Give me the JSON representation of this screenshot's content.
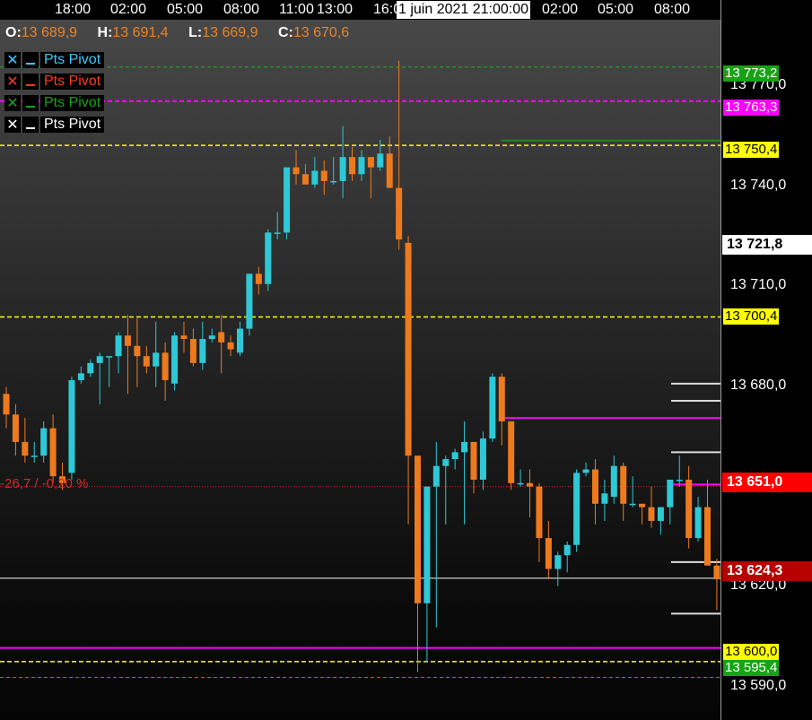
{
  "time_axis": {
    "labels": [
      "18:00",
      "02:00",
      "05:00",
      "08:00",
      "11:00",
      "13:00",
      "16:0",
      "02:00",
      "05:00",
      "08:00"
    ],
    "crosshair_time": "1 juin 2021 21:00:00"
  },
  "ohlc": {
    "open_label": "O:",
    "open": "13 689,9",
    "high_label": "H:",
    "high": "13 691,4",
    "low_label": "L:",
    "low": "13 669,9",
    "close_label": "C:",
    "close": "13 670,6"
  },
  "pivot_legends": [
    {
      "name": "Pts Pivot",
      "color": "#3fc8ff",
      "close_glyph": "✕"
    },
    {
      "name": "Pts Pivot",
      "color": "#ff3b1f",
      "close_glyph": "✕"
    },
    {
      "name": "Pts Pivot",
      "color": "#17a317",
      "close_glyph": "✕"
    },
    {
      "name": "Pts Pivot",
      "color": "#ffffff",
      "close_glyph": "✕"
    }
  ],
  "variation_label": "-26,7 / -0,20 %",
  "price_axis": {
    "ticks": [
      "13 770,0",
      "13 740,0",
      "13 710,0",
      "13 680,0",
      "13 620,0",
      "13 590,0"
    ],
    "badges": [
      {
        "label": "13 773,2",
        "bg": "#16a316",
        "fg": "#ffffff"
      },
      {
        "label": "13 763,3",
        "bg": "#ff00ff",
        "fg": "#ffffff"
      },
      {
        "label": "13 750,4",
        "bg": "#ffff00",
        "fg": "#000000"
      },
      {
        "label": "13 721,8",
        "bg": "#ffffff",
        "fg": "#000000",
        "big": true
      },
      {
        "label": "13 700,4",
        "bg": "#ffff00",
        "fg": "#000000"
      },
      {
        "label": "13 651,0",
        "bg": "#ff0000",
        "fg": "#ffffff",
        "big": true
      },
      {
        "label": "13 624,3",
        "bg": "#b80000",
        "fg": "#ffffff",
        "big": true
      },
      {
        "label": "13 600,0",
        "bg": "#ffff00",
        "fg": "#000000"
      },
      {
        "label": "13 595,4",
        "bg": "#16a316",
        "fg": "#ffffff"
      }
    ]
  },
  "colors": {
    "bull": "#2ec9d6",
    "bear": "#ee7a1e",
    "wick": "#d9d9d9",
    "pivot_green": "#1fb31f",
    "pivot_magenta": "#ff00ff",
    "pivot_yellow": "#ffff00",
    "current_price_line": "#ffffff",
    "reference_line": "#d21a1a"
  },
  "chart_data": {
    "type": "candlestick",
    "price_range": [
      13583,
      13787
    ],
    "pivot_levels": {
      "green": [
        13773.2,
        13595.4
      ],
      "magenta": [
        13763.3,
        13604.0
      ],
      "yellow": [
        13750.4,
        13700.4,
        13600.0
      ]
    },
    "current_price": 13624.3,
    "reference_price": 13651.0,
    "candles": [
      {
        "o": 13678,
        "h": 13680,
        "l": 13668,
        "c": 13672
      },
      {
        "o": 13672,
        "h": 13675,
        "l": 13660,
        "c": 13664
      },
      {
        "o": 13664,
        "h": 13671,
        "l": 13658,
        "c": 13660
      },
      {
        "o": 13660,
        "h": 13664,
        "l": 13658,
        "c": 13660
      },
      {
        "o": 13660,
        "h": 13670,
        "l": 13658,
        "c": 13668
      },
      {
        "o": 13668,
        "h": 13672,
        "l": 13652,
        "c": 13654
      },
      {
        "o": 13654,
        "h": 13658,
        "l": 13650,
        "c": 13652
      },
      {
        "o": 13655,
        "h": 13683,
        "l": 13653,
        "c": 13682
      },
      {
        "o": 13682,
        "h": 13686,
        "l": 13681,
        "c": 13684
      },
      {
        "o": 13684,
        "h": 13688,
        "l": 13683,
        "c": 13687
      },
      {
        "o": 13687,
        "h": 13690,
        "l": 13675,
        "c": 13689
      },
      {
        "o": 13689,
        "h": 13689,
        "l": 13680,
        "c": 13689
      },
      {
        "o": 13689,
        "h": 13696,
        "l": 13684,
        "c": 13695
      },
      {
        "o": 13695,
        "h": 13701,
        "l": 13678,
        "c": 13692
      },
      {
        "o": 13692,
        "h": 13700,
        "l": 13680,
        "c": 13689
      },
      {
        "o": 13689,
        "h": 13692,
        "l": 13684,
        "c": 13686
      },
      {
        "o": 13686,
        "h": 13699,
        "l": 13680,
        "c": 13690
      },
      {
        "o": 13690,
        "h": 13693,
        "l": 13676,
        "c": 13682
      },
      {
        "o": 13681,
        "h": 13696,
        "l": 13679,
        "c": 13695
      },
      {
        "o": 13695,
        "h": 13699,
        "l": 13690,
        "c": 13694
      },
      {
        "o": 13694,
        "h": 13697,
        "l": 13686,
        "c": 13687
      },
      {
        "o": 13687,
        "h": 13699,
        "l": 13685,
        "c": 13694
      },
      {
        "o": 13694,
        "h": 13697,
        "l": 13693,
        "c": 13695
      },
      {
        "o": 13696,
        "h": 13701,
        "l": 13684,
        "c": 13693
      },
      {
        "o": 13693,
        "h": 13695,
        "l": 13689,
        "c": 13691
      },
      {
        "o": 13690,
        "h": 13699,
        "l": 13689,
        "c": 13697
      },
      {
        "o": 13697,
        "h": 13710,
        "l": 13695,
        "c": 13713
      },
      {
        "o": 13713,
        "h": 13715,
        "l": 13707,
        "c": 13710
      },
      {
        "o": 13710,
        "h": 13726,
        "l": 13708,
        "c": 13725
      },
      {
        "o": 13725,
        "h": 13731,
        "l": 13723,
        "c": 13725
      },
      {
        "o": 13725,
        "h": 13744,
        "l": 13723,
        "c": 13744
      },
      {
        "o": 13744,
        "h": 13749,
        "l": 13739,
        "c": 13742
      },
      {
        "o": 13742,
        "h": 13745,
        "l": 13739,
        "c": 13739
      },
      {
        "o": 13739,
        "h": 13747,
        "l": 13738,
        "c": 13743
      },
      {
        "o": 13743,
        "h": 13746,
        "l": 13736,
        "c": 13740
      },
      {
        "o": 13740,
        "h": 13747,
        "l": 13739,
        "c": 13740
      },
      {
        "o": 13740,
        "h": 13756,
        "l": 13735,
        "c": 13747
      },
      {
        "o": 13747,
        "h": 13750,
        "l": 13740,
        "c": 13742
      },
      {
        "o": 13742,
        "h": 13749,
        "l": 13740,
        "c": 13747
      },
      {
        "o": 13747,
        "h": 13747,
        "l": 13735,
        "c": 13744
      },
      {
        "o": 13744,
        "h": 13752,
        "l": 13743,
        "c": 13748
      },
      {
        "o": 13748,
        "h": 13753,
        "l": 13740,
        "c": 13738
      },
      {
        "o": 13738,
        "h": 13775,
        "l": 13720,
        "c": 13723
      },
      {
        "o": 13722,
        "h": 13724,
        "l": 13640,
        "c": 13660
      },
      {
        "o": 13660,
        "h": 13660,
        "l": 13597,
        "c": 13617
      },
      {
        "o": 13617,
        "h": 13618,
        "l": 13600,
        "c": 13651
      },
      {
        "o": 13651,
        "h": 13664,
        "l": 13610,
        "c": 13657
      },
      {
        "o": 13657,
        "h": 13660,
        "l": 13640,
        "c": 13659
      },
      {
        "o": 13659,
        "h": 13662,
        "l": 13656,
        "c": 13661
      },
      {
        "o": 13661,
        "h": 13670,
        "l": 13640,
        "c": 13664
      },
      {
        "o": 13664,
        "h": 13660,
        "l": 13649,
        "c": 13653
      },
      {
        "o": 13653,
        "h": 13667,
        "l": 13650,
        "c": 13665
      },
      {
        "o": 13665,
        "h": 13684,
        "l": 13664,
        "c": 13683
      },
      {
        "o": 13683,
        "h": 13684,
        "l": 13663,
        "c": 13670
      },
      {
        "o": 13670,
        "h": 13668,
        "l": 13650,
        "c": 13652
      },
      {
        "o": 13652,
        "h": 13656,
        "l": 13651,
        "c": 13652
      },
      {
        "o": 13652,
        "h": 13656,
        "l": 13642,
        "c": 13651
      },
      {
        "o": 13651,
        "h": 13652,
        "l": 13629,
        "c": 13636
      },
      {
        "o": 13636,
        "h": 13641,
        "l": 13624,
        "c": 13627
      },
      {
        "o": 13627,
        "h": 13632,
        "l": 13622,
        "c": 13631
      },
      {
        "o": 13631,
        "h": 13635,
        "l": 13626,
        "c": 13634
      },
      {
        "o": 13634,
        "h": 13656,
        "l": 13632,
        "c": 13655
      },
      {
        "o": 13655,
        "h": 13658,
        "l": 13654,
        "c": 13656
      },
      {
        "o": 13656,
        "h": 13659,
        "l": 13640,
        "c": 13646
      },
      {
        "o": 13646,
        "h": 13653,
        "l": 13641,
        "c": 13649
      },
      {
        "o": 13648,
        "h": 13660,
        "l": 13646,
        "c": 13657
      },
      {
        "o": 13657,
        "h": 13658,
        "l": 13641,
        "c": 13646
      },
      {
        "o": 13646,
        "h": 13654,
        "l": 13645,
        "c": 13646
      },
      {
        "o": 13646,
        "h": 13646,
        "l": 13640,
        "c": 13645
      },
      {
        "o": 13645,
        "h": 13651,
        "l": 13639,
        "c": 13641
      },
      {
        "o": 13641,
        "h": 13645,
        "l": 13637,
        "c": 13645
      },
      {
        "o": 13645,
        "h": 13650,
        "l": 13640,
        "c": 13653
      },
      {
        "o": 13653,
        "h": 13660,
        "l": 13651,
        "c": 13653
      },
      {
        "o": 13653,
        "h": 13657,
        "l": 13633,
        "c": 13636
      },
      {
        "o": 13636,
        "h": 13648,
        "l": 13635,
        "c": 13645
      },
      {
        "o": 13645,
        "h": 13653,
        "l": 13630,
        "c": 13628
      },
      {
        "o": 13628,
        "h": 13630,
        "l": 13615,
        "c": 13624
      }
    ]
  }
}
